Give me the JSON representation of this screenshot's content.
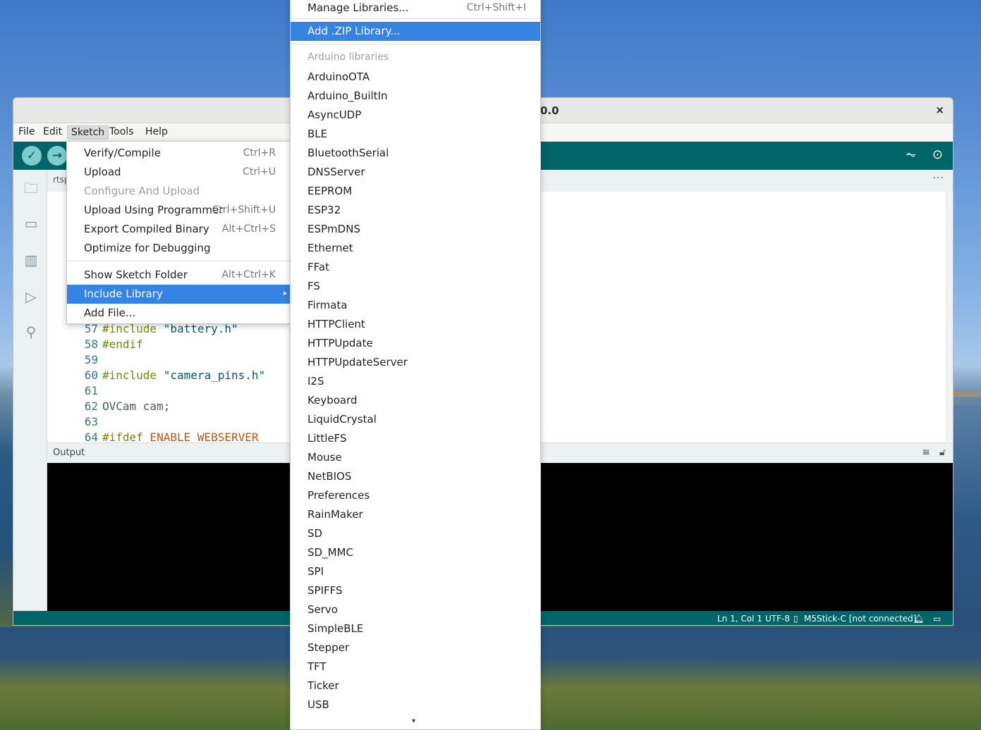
{
  "window": {
    "title": "0.0",
    "close": "×"
  },
  "menubar": [
    "File",
    "Edit",
    "Sketch",
    "Tools",
    "Help"
  ],
  "tab": {
    "name": "rtsp"
  },
  "code": [
    {
      "ln": "57",
      "pre": "",
      "kw": "#include",
      "str": " \"battery.h\""
    },
    {
      "ln": "58",
      "pre": "",
      "kw": "#endif",
      "str": ""
    },
    {
      "ln": "59",
      "pre": "",
      "kw": "",
      "str": ""
    },
    {
      "ln": "60",
      "pre": "",
      "kw": "#include",
      "str": " \"camera_pins.h\""
    },
    {
      "ln": "61",
      "pre": "",
      "kw": "",
      "str": ""
    },
    {
      "ln": "62",
      "pre": "OVCam cam;",
      "kw": "",
      "str": ""
    },
    {
      "ln": "63",
      "pre": "",
      "kw": "",
      "str": ""
    },
    {
      "ln": "64",
      "pre": "",
      "kw": "#ifdef",
      "str": " ENABLE_WEBSERVER"
    }
  ],
  "output": {
    "label": "Output"
  },
  "status": {
    "position": "Ln 1, Col 1",
    "encoding": "UTF-8",
    "board": "M5Stick-C [not connected]"
  },
  "sketch_menu": [
    {
      "label": "Verify/Compile",
      "acc": "Ctrl+R",
      "disabled": false
    },
    {
      "label": "Upload",
      "acc": "Ctrl+U",
      "disabled": false
    },
    {
      "label": "Configure And Upload",
      "acc": "",
      "disabled": true
    },
    {
      "label": "Upload Using Programmer",
      "acc": "Ctrl+Shift+U",
      "disabled": false
    },
    {
      "label": "Export Compiled Binary",
      "acc": "Alt+Ctrl+S",
      "disabled": false
    },
    {
      "label": "Optimize for Debugging",
      "acc": "",
      "disabled": false
    },
    {
      "label": "Show Sketch Folder",
      "acc": "Alt+Ctrl+K",
      "disabled": false
    },
    {
      "label": "Include Library",
      "acc": "",
      "disabled": false
    },
    {
      "label": "Add File...",
      "acc": "",
      "disabled": false
    }
  ],
  "library_menu": {
    "manage": {
      "label": "Manage Libraries...",
      "acc": "Ctrl+Shift+I"
    },
    "add_zip": "Add .ZIP Library...",
    "section_header": "Arduino libraries",
    "items": [
      "ArduinoOTA",
      "Arduino_BuiltIn",
      "AsyncUDP",
      "BLE",
      "BluetoothSerial",
      "DNSServer",
      "EEPROM",
      "ESP32",
      "ESPmDNS",
      "Ethernet",
      "FFat",
      "FS",
      "Firmata",
      "HTTPClient",
      "HTTPUpdate",
      "HTTPUpdateServer",
      "I2S",
      "Keyboard",
      "LiquidCrystal",
      "LittleFS",
      "Mouse",
      "NetBIOS",
      "Preferences",
      "RainMaker",
      "SD",
      "SD_MMC",
      "SPI",
      "SPIFFS",
      "Servo",
      "SimpleBLE",
      "Stepper",
      "TFT",
      "Ticker",
      "USB"
    ]
  },
  "colors": {
    "accent": "#006468",
    "selection": "#3584e4"
  }
}
